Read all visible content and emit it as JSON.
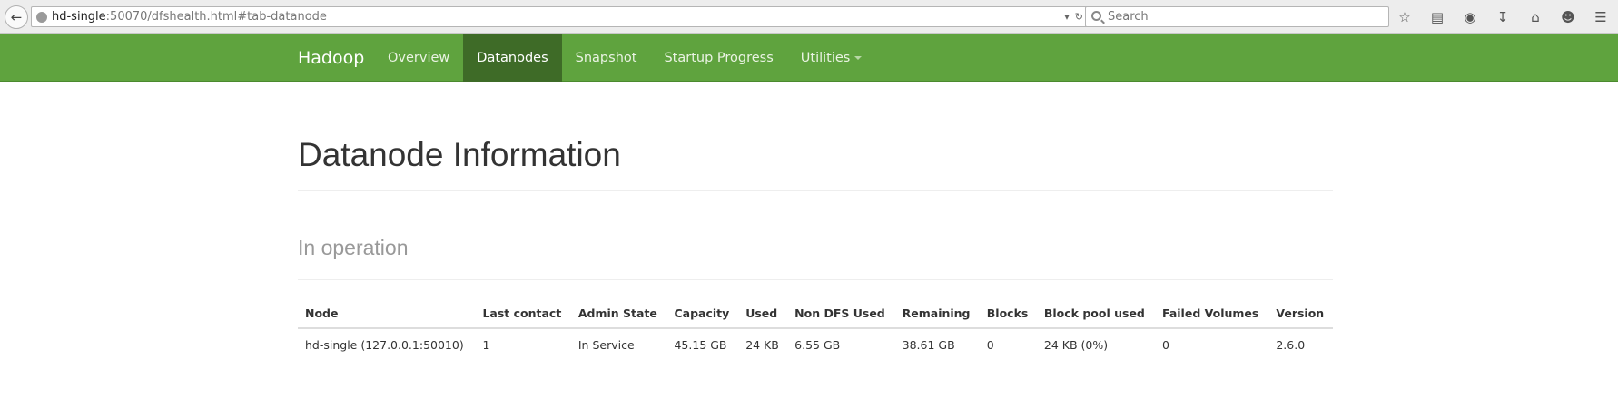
{
  "browser": {
    "url_host": "hd-single",
    "url_rest": ":50070/dfshealth.html#tab-datanode",
    "search_placeholder": "Search"
  },
  "navbar": {
    "brand": "Hadoop",
    "items": [
      {
        "label": "Overview"
      },
      {
        "label": "Datanodes"
      },
      {
        "label": "Snapshot"
      },
      {
        "label": "Startup Progress"
      },
      {
        "label": "Utilities"
      }
    ],
    "active_index": 1
  },
  "page": {
    "title": "Datanode Information",
    "section_title": "In operation"
  },
  "table": {
    "headers": [
      "Node",
      "Last contact",
      "Admin State",
      "Capacity",
      "Used",
      "Non DFS Used",
      "Remaining",
      "Blocks",
      "Block pool used",
      "Failed Volumes",
      "Version"
    ],
    "rows": [
      [
        "hd-single (127.0.0.1:50010)",
        "1",
        "In Service",
        "45.15 GB",
        "24 KB",
        "6.55 GB",
        "38.61 GB",
        "0",
        "24 KB (0%)",
        "0",
        "2.6.0"
      ]
    ]
  },
  "colors": {
    "navbar_bg": "#5fa33e",
    "navbar_active": "#3e6b27"
  }
}
